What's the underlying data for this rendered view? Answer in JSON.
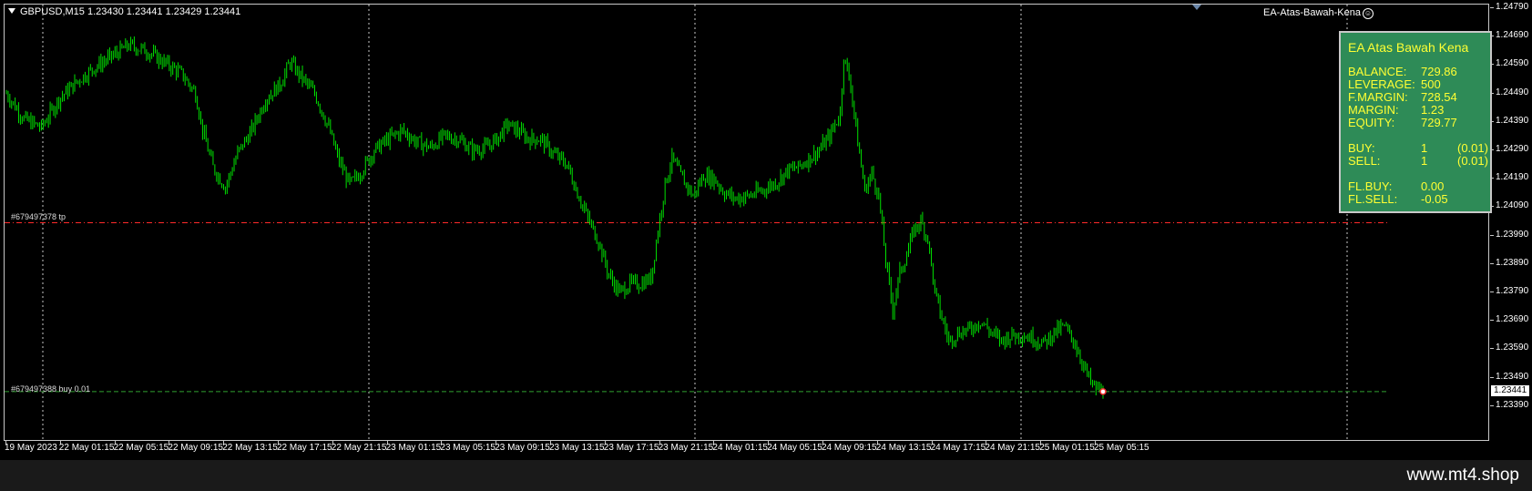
{
  "header": {
    "symbol_line": "GBPUSD,M15  1.23430  1.23441  1.23429  1.23441",
    "ea_name": "EA-Atas-Bawah-Kena",
    "ea_icon": "smiley-icon"
  },
  "orders": {
    "tp_label": "#679497378 tp",
    "buy_label": "#679497388 buy 0.01"
  },
  "colors": {
    "background": "#000000",
    "candle": "#00e000",
    "tp_line": "#ff2a2a",
    "price_line": "#30a030",
    "panel_bg": "#2e8b57",
    "panel_text": "#ffff33"
  },
  "panel": {
    "title": "EA Atas Bawah Kena",
    "rows": [
      {
        "k": "BALANCE:",
        "v": "729.86",
        "x": ""
      },
      {
        "k": "LEVERAGE:",
        "v": "500",
        "x": ""
      },
      {
        "k": "F.MARGIN:",
        "v": "728.54",
        "x": ""
      },
      {
        "k": "MARGIN:",
        "v": "1.23",
        "x": ""
      },
      {
        "k": "EQUITY:",
        "v": "729.77",
        "x": ""
      },
      {
        "k": "",
        "v": "",
        "x": ""
      },
      {
        "k": "BUY:",
        "v": "1",
        "x": "(0.01)"
      },
      {
        "k": "SELL:",
        "v": "1",
        "x": "(0.01)"
      },
      {
        "k": "",
        "v": "",
        "x": ""
      },
      {
        "k": "FL.BUY:",
        "v": "0.00",
        "x": ""
      },
      {
        "k": "FL.SELL:",
        "v": "-0.05",
        "x": ""
      }
    ]
  },
  "price_axis": {
    "labels": [
      "1.24790",
      "1.24690",
      "1.24590",
      "1.24490",
      "1.24390",
      "1.24290",
      "1.24190",
      "1.24090",
      "1.23990",
      "1.23890",
      "1.23790",
      "1.23690",
      "1.23590",
      "1.23490",
      "1.23390"
    ],
    "current": "1.23441"
  },
  "time_axis": {
    "labels": [
      "19 May 2023",
      "22 May 01:15",
      "22 May 05:15",
      "22 May 09:15",
      "22 May 13:15",
      "22 May 17:15",
      "22 May 21:15",
      "23 May 01:15",
      "23 May 05:15",
      "23 May 09:15",
      "23 May 13:15",
      "23 May 17:15",
      "23 May 21:15",
      "24 May 01:15",
      "24 May 05:15",
      "24 May 09:15",
      "24 May 13:15",
      "24 May 17:15",
      "24 May 21:15",
      "25 May 01:15",
      "25 May 05:15"
    ]
  },
  "chart_data": {
    "type": "candlestick",
    "symbol": "GBPUSD",
    "timeframe": "M15",
    "ylim": [
      1.2339,
      1.2479
    ],
    "tp_price": 1.24035,
    "current_price": 1.23441,
    "grid": "vertical dotted at day separators",
    "close_path": [
      [
        0,
        1.2449
      ],
      [
        10,
        1.244
      ],
      [
        20,
        1.2437
      ],
      [
        30,
        1.2447
      ],
      [
        40,
        1.2453
      ],
      [
        50,
        1.2458
      ],
      [
        60,
        1.2462
      ],
      [
        70,
        1.2466
      ],
      [
        80,
        1.2464
      ],
      [
        90,
        1.246
      ],
      [
        100,
        1.2456
      ],
      [
        108,
        1.2449
      ],
      [
        112,
        1.2436
      ],
      [
        118,
        1.2423
      ],
      [
        125,
        1.2416
      ],
      [
        132,
        1.2428
      ],
      [
        140,
        1.2436
      ],
      [
        148,
        1.2447
      ],
      [
        156,
        1.2452
      ],
      [
        162,
        1.246
      ],
      [
        168,
        1.2455
      ],
      [
        176,
        1.2449
      ],
      [
        184,
        1.2437
      ],
      [
        190,
        1.2425
      ],
      [
        196,
        1.2417
      ],
      [
        202,
        1.2421
      ],
      [
        210,
        1.2429
      ],
      [
        218,
        1.2433
      ],
      [
        226,
        1.2436
      ],
      [
        234,
        1.2432
      ],
      [
        242,
        1.243
      ],
      [
        250,
        1.2434
      ],
      [
        258,
        1.2433
      ],
      [
        266,
        1.2429
      ],
      [
        274,
        1.243
      ],
      [
        280,
        1.2433
      ],
      [
        286,
        1.2438
      ],
      [
        292,
        1.2436
      ],
      [
        298,
        1.2433
      ],
      [
        305,
        1.2433
      ],
      [
        312,
        1.2428
      ],
      [
        320,
        1.2424
      ],
      [
        326,
        1.2414
      ],
      [
        332,
        1.2405
      ],
      [
        338,
        1.2397
      ],
      [
        344,
        1.2385
      ],
      [
        350,
        1.2379
      ],
      [
        356,
        1.2382
      ],
      [
        362,
        1.2382
      ],
      [
        368,
        1.2384
      ],
      [
        372,
        1.2401
      ],
      [
        376,
        1.2417
      ],
      [
        380,
        1.2426
      ],
      [
        386,
        1.2419
      ],
      [
        392,
        1.2413
      ],
      [
        398,
        1.242
      ],
      [
        404,
        1.2419
      ],
      [
        410,
        1.2414
      ],
      [
        416,
        1.2412
      ],
      [
        424,
        1.2413
      ],
      [
        432,
        1.2415
      ],
      [
        440,
        1.2418
      ],
      [
        446,
        1.2422
      ],
      [
        452,
        1.2423
      ],
      [
        458,
        1.2426
      ],
      [
        464,
        1.2429
      ],
      [
        470,
        1.2434
      ],
      [
        476,
        1.2442
      ],
      [
        478,
        1.2462
      ],
      [
        482,
        1.2452
      ],
      [
        486,
        1.2432
      ],
      [
        490,
        1.2415
      ],
      [
        494,
        1.2421
      ],
      [
        498,
        1.2413
      ],
      [
        502,
        1.239
      ],
      [
        506,
        1.2373
      ],
      [
        510,
        1.2386
      ],
      [
        514,
        1.2392
      ],
      [
        518,
        1.2401
      ],
      [
        522,
        1.2404
      ],
      [
        526,
        1.2398
      ],
      [
        530,
        1.2379
      ],
      [
        534,
        1.237
      ],
      [
        538,
        1.2362
      ],
      [
        544,
        1.2365
      ],
      [
        550,
        1.2366
      ],
      [
        556,
        1.2369
      ],
      [
        562,
        1.2365
      ],
      [
        568,
        1.2362
      ],
      [
        574,
        1.2364
      ],
      [
        580,
        1.2364
      ],
      [
        586,
        1.2363
      ],
      [
        592,
        1.2361
      ],
      [
        598,
        1.2365
      ],
      [
        604,
        1.2367
      ],
      [
        610,
        1.2361
      ],
      [
        615,
        1.2353
      ],
      [
        620,
        1.2346
      ],
      [
        626,
        1.2344
      ]
    ]
  }
}
